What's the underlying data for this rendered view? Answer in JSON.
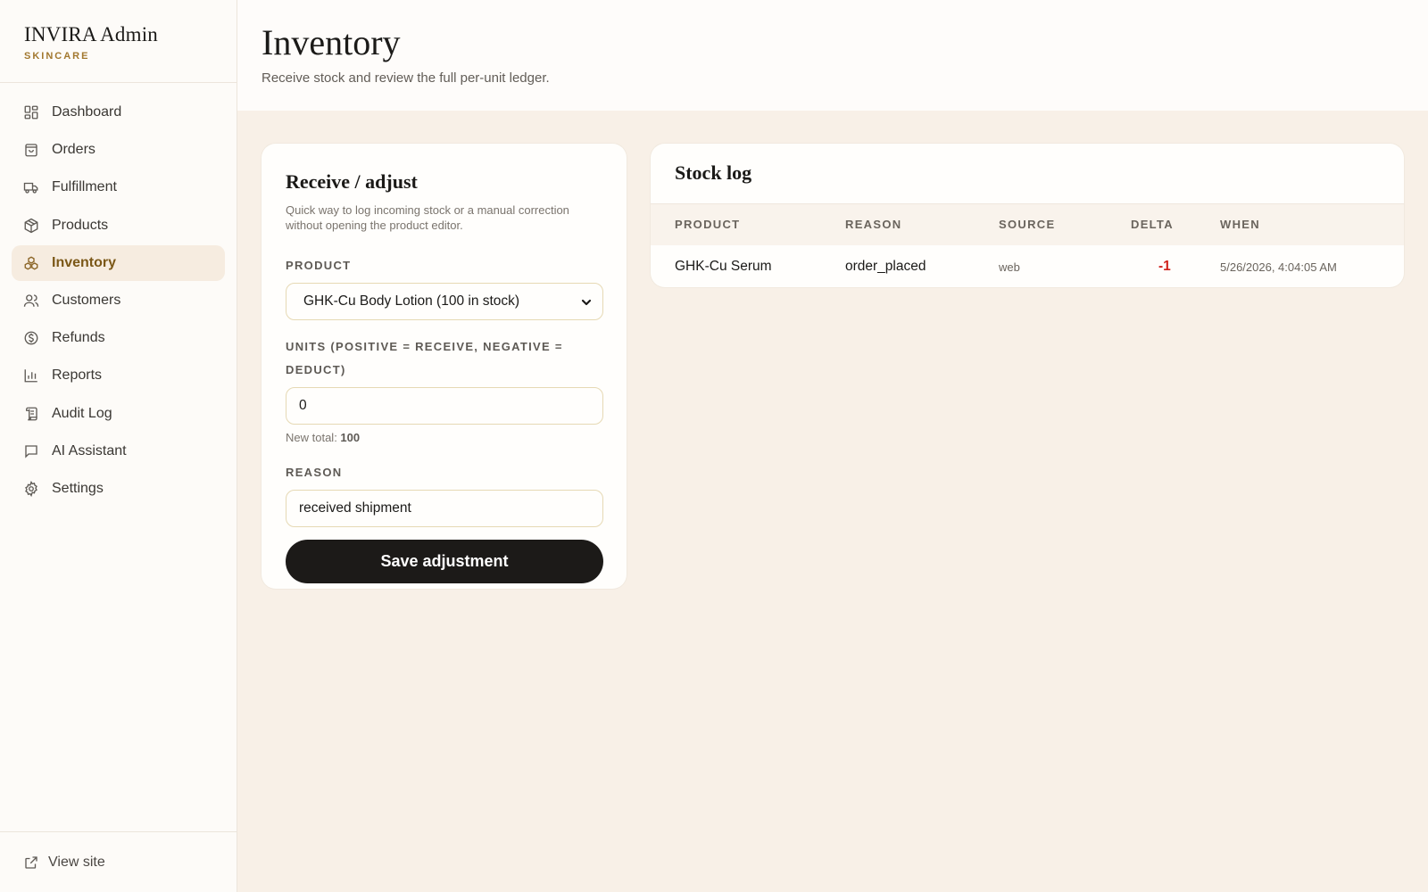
{
  "brand": {
    "title": "INVIRA Admin",
    "subtitle": "SKINCARE"
  },
  "nav": [
    {
      "label": "Dashboard",
      "icon": "dashboard-icon"
    },
    {
      "label": "Orders",
      "icon": "bag-icon"
    },
    {
      "label": "Fulfillment",
      "icon": "truck-icon"
    },
    {
      "label": "Products",
      "icon": "box-icon"
    },
    {
      "label": "Inventory",
      "icon": "stack-icon",
      "active": true
    },
    {
      "label": "Customers",
      "icon": "users-icon"
    },
    {
      "label": "Refunds",
      "icon": "dollar-icon"
    },
    {
      "label": "Reports",
      "icon": "bar-chart-icon"
    },
    {
      "label": "Audit Log",
      "icon": "scroll-icon"
    },
    {
      "label": "AI Assistant",
      "icon": "chat-icon"
    },
    {
      "label": "Settings",
      "icon": "gear-icon"
    }
  ],
  "footer": {
    "view_site": "View site",
    "icon": "external-link-icon"
  },
  "header": {
    "title": "Inventory",
    "subtitle": "Receive stock and review the full per-unit ledger."
  },
  "adjust": {
    "title": "Receive / adjust",
    "description_line1": "Quick way to log incoming stock or a manual correction",
    "description_line2": "without opening the product editor.",
    "product_label": "PRODUCT",
    "product_value": "GHK-Cu Body Lotion (100 in stock)",
    "units_label_line1": "UNITS (POSITIVE = RECEIVE, NEGATIVE =",
    "units_label_line2": "DEDUCT)",
    "units_value": "0",
    "new_total_label": "New total: ",
    "new_total_value": "100",
    "reason_label": "REASON",
    "reason_value": "received shipment",
    "save_label": "Save adjustment"
  },
  "stock_log": {
    "title": "Stock log",
    "columns": {
      "product": "PRODUCT",
      "reason": "REASON",
      "source": "SOURCE",
      "delta": "DELTA",
      "when": "WHEN"
    },
    "rows": [
      {
        "product": "GHK-Cu Serum",
        "reason": "order_placed",
        "source": "web",
        "delta": "-1",
        "when": "5/26/2026, 4:04:05 AM"
      }
    ]
  },
  "colors": {
    "accent": "#a2782f",
    "active_text": "#7b5818",
    "active_bg": "#f6ece0",
    "page_bg": "#f8f0e7",
    "button_bg": "#1c1a18",
    "negative_delta": "#d0221c"
  }
}
